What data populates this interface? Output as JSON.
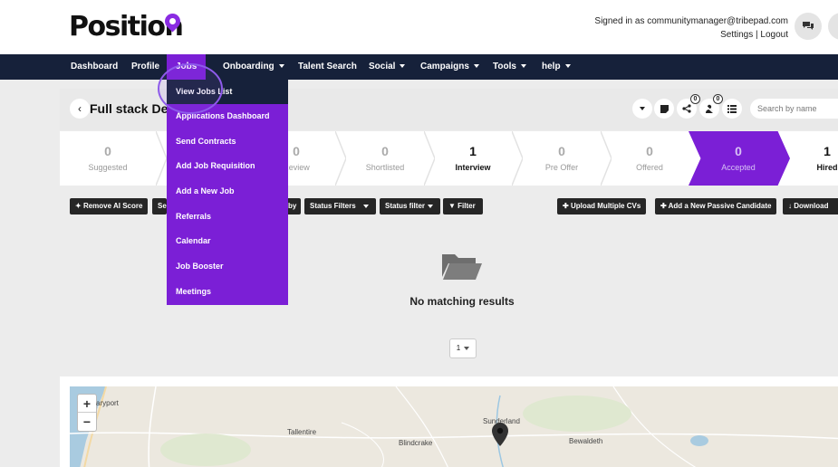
{
  "header": {
    "logo_text": "Position",
    "signed_in": "Signed in as communitymanager@tribepad.com",
    "settings": "Settings",
    "separator": "|",
    "logout": "Logout"
  },
  "nav": [
    {
      "label": "Dashboard",
      "caret": false
    },
    {
      "label": "Profile",
      "caret": false
    },
    {
      "label": "Jobs",
      "caret": false
    },
    {
      "label": "Onboarding",
      "caret": true
    },
    {
      "label": "Talent Search",
      "caret": false
    },
    {
      "label": "Social",
      "caret": true
    },
    {
      "label": "Campaigns",
      "caret": true
    },
    {
      "label": "Tools",
      "caret": true
    },
    {
      "label": "help",
      "caret": true
    }
  ],
  "jobs_menu": [
    "View Jobs List",
    "Applications Dashboard",
    "Send Contracts",
    "Add Job Requisition",
    "Add a New Job",
    "Referrals",
    "Calendar",
    "Job Booster",
    "Meetings"
  ],
  "job": {
    "title": "Full stack Dev",
    "share_count": "0",
    "user_count": "0",
    "search_placeholder": "Search by name"
  },
  "pipeline": [
    {
      "count": "0",
      "label": "Suggested"
    },
    {
      "count": "",
      "label": ""
    },
    {
      "count": "0",
      "label": "Review"
    },
    {
      "count": "0",
      "label": "Shortlisted"
    },
    {
      "count": "1",
      "label": "Interview"
    },
    {
      "count": "0",
      "label": "Pre Offer"
    },
    {
      "count": "0",
      "label": "Offered"
    },
    {
      "count": "0",
      "label": "Accepted"
    },
    {
      "count": "1",
      "label": "Hired"
    }
  ],
  "filters": {
    "remove_ai": "Remove AI Score",
    "sel": "Se",
    "by": "by",
    "status_filters": "Status Filters",
    "status_filter": "Status filter",
    "filter": "Filter",
    "upload_cvs": "Upload Multiple CVs",
    "add_passive": "Add a New Passive Candidate",
    "download": "Download"
  },
  "empty": {
    "message": "No matching results",
    "page": "1"
  },
  "map": {
    "zoom_in": "+",
    "zoom_out": "−",
    "places": [
      "aryport",
      "Tallentire",
      "Blindcrake",
      "Sunderland",
      "Bewaldeth"
    ]
  },
  "colors": {
    "nav_bg": "#16213a",
    "accent": "#7b1fd6"
  }
}
